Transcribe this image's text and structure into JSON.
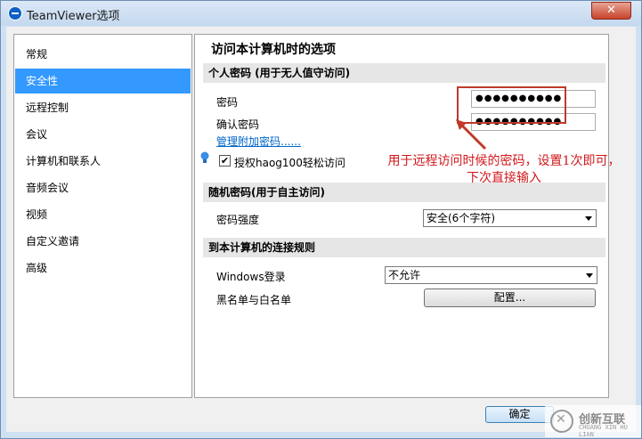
{
  "window": {
    "title": "TeamViewer选项",
    "close_label": "✕"
  },
  "sidebar": {
    "items": [
      {
        "label": "常规"
      },
      {
        "label": "安全性",
        "selected": true
      },
      {
        "label": "远程控制"
      },
      {
        "label": "会议"
      },
      {
        "label": "计算机和联系人"
      },
      {
        "label": "音频会议"
      },
      {
        "label": "视频"
      },
      {
        "label": "自定义邀请"
      },
      {
        "label": "高级"
      }
    ]
  },
  "panel": {
    "title": "访问本计算机时的选项",
    "personal_section": "个人密码 (用于无人值守访问)",
    "password_label": "密码",
    "password_value": "●●●●●●●●●●",
    "confirm_label": "确认密码",
    "confirm_value": "●●●●●●●●●●",
    "manage_link": "管理附加密码......",
    "grant_checkbox_label": "授权haog100轻松访问",
    "grant_checked": true,
    "random_section": "随机密码(用于自主访问)",
    "strength_label": "密码强度",
    "strength_value": "安全(6个字符)",
    "rules_section": "到本计算机的连接规则",
    "windows_login_label": "Windows登录",
    "windows_login_value": "不允许",
    "blacklist_label": "黑名单与白名单",
    "configure_button": "配置..."
  },
  "annotation": {
    "line1": "用于远程访问时候的密码，设置1次即可，",
    "line2": "下次直接输入"
  },
  "footer": {
    "ok_button": "确定"
  },
  "watermark": {
    "brand": "创新互联",
    "sub": "CHUANG XIN HU LIAN"
  },
  "colors": {
    "selection": "#3399ff",
    "annotation": "#d0191c",
    "link": "#0066cc"
  }
}
